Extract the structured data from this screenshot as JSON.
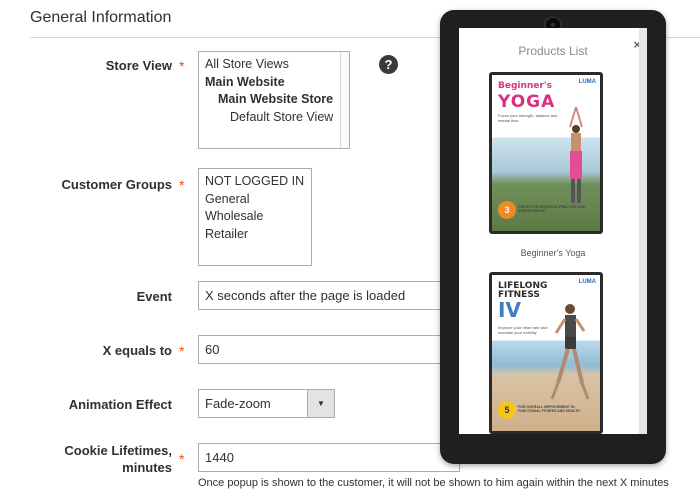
{
  "section": {
    "title": "General Information"
  },
  "store_view": {
    "label": "Store View",
    "options": [
      "All Store Views",
      "Main Website",
      "Main Website Store",
      "Default Store View"
    ]
  },
  "help_icon": "?",
  "customer_groups": {
    "label": "Customer Groups",
    "options": [
      "NOT LOGGED IN",
      "General",
      "Wholesale",
      "Retailer"
    ]
  },
  "event": {
    "label": "Event",
    "value": "X seconds after the page is loaded"
  },
  "x_equals": {
    "label": "X equals to",
    "value": "60"
  },
  "animation": {
    "label": "Animation Effect",
    "value": "Fade-zoom",
    "arrow": "▼"
  },
  "cookie": {
    "label_line1": "Cookie Lifetimes,",
    "label_line2": "minutes",
    "value": "1440",
    "note": "Once popup is shown to the customer, it will not be shown to him again within the next X minutes"
  },
  "required_mark": "*",
  "popup": {
    "title": "Products List",
    "close": "×",
    "products": [
      {
        "name": "Beginner's Yoga",
        "cover_title_1": "Beginner's",
        "cover_title_2": "YOGA",
        "brand": "LUMA",
        "cover_text": "Focus your strength, balance and mental flow",
        "badge": "3",
        "footer_text": "GREAT FOR EVERYDAY PRACTICE AND STRESS RELIEF"
      },
      {
        "name": "Lifelong Fitness IV",
        "cover_title_1": "LIFELONG",
        "cover_title_2": "FITNESS",
        "cover_title_3": "IV",
        "brand": "LUMA",
        "cover_text": "Improve your heart rate and increase your mobility",
        "badge": "5",
        "footer_text": "FOR OVERALL IMPROVEMENT IN FUNCTIONAL FITNESS AND HEALTH"
      }
    ]
  },
  "colors": {
    "required": "#eb5202",
    "yoga_pink": "#d6327f",
    "fitness_blue": "#3d7fc1",
    "badge_orange": "#f08a24",
    "badge_yellow": "#f5c518"
  }
}
